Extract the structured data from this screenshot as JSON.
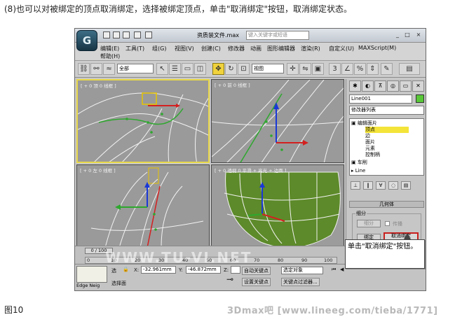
{
  "caption_top": "(8)也可以对被绑定的顶点取消绑定，选择被绑定顶点，单击\"取消绑定\"按钮，取消绑定状态。",
  "caption_bottom": "图10",
  "watermark_bottom": "3Dmax吧  [www.lineeg.com/tieba/1771]",
  "watermark_mid": "WWW.TU-VI.NET",
  "app": {
    "logo": "G",
    "title": "资质装文件.max",
    "search_placeholder": "键入关键字或短语",
    "window_buttons": [
      "_",
      "□",
      "×"
    ]
  },
  "menu": {
    "row1": [
      "编辑(E)",
      "工具(T)",
      "组(G)",
      "视图(V)",
      "创建(C)",
      "修改器",
      "动画",
      "图形编辑器",
      "渲染(R)",
      "自定义(U)",
      "MAXScript(M)"
    ],
    "row2": [
      "帮助(H)"
    ]
  },
  "toolbar": {
    "selection_filter": "全部",
    "reference_coord": "视图",
    "tool_icons": [
      "link-icon",
      "unlink-icon",
      "bind-space-warp-icon",
      "select-icon",
      "select-by-name-icon",
      "rect-select-icon",
      "window-crossing-icon",
      "move-icon",
      "rotate-icon",
      "scale-icon",
      "pivot-icon",
      "mirror-icon",
      "align-icon",
      "snap-icon",
      "angle-snap-icon",
      "percent-snap-icon",
      "spinner-snap-icon",
      "named-selection-icon",
      "render-icon"
    ]
  },
  "viewports": [
    {
      "label": "[ + 0 顶 0 线框 ]",
      "active": true
    },
    {
      "label": "[ + 0 前 0 线框 ]",
      "active": false
    },
    {
      "label": "[ + 0 左 0 线框 ]",
      "active": false
    },
    {
      "label": "[ + 0 透视 0 平滑 + 高光 + 边面 ]",
      "active": false
    }
  ],
  "command_panel": {
    "tabs": [
      "create-tab",
      "modify-tab",
      "hierarchy-tab",
      "motion-tab",
      "display-tab",
      "utilities-tab"
    ],
    "object_name": "Line001",
    "object_color": "#58c838",
    "modifier_list": "修改器列表",
    "stack": [
      {
        "text": "编辑面片",
        "level": 0,
        "selected": false
      },
      {
        "text": "顶点",
        "level": 1,
        "selected": true
      },
      {
        "text": "边",
        "level": 1,
        "selected": false
      },
      {
        "text": "面片",
        "level": 1,
        "selected": false
      },
      {
        "text": "元素",
        "level": 1,
        "selected": false
      },
      {
        "text": "控制柄",
        "level": 1,
        "selected": false
      },
      {
        "text": "车削",
        "level": 0,
        "selected": false
      },
      {
        "text": "Line",
        "level": 0,
        "selected": false
      }
    ],
    "rollout_title": "几何体",
    "group_title": "细分",
    "btn_subdivide": "细分",
    "chk_propagate": "传播",
    "btn_bind": "绑定",
    "btn_unbind": "取消绑定"
  },
  "callout": "单击\"取消绑定\"按钮。",
  "timeline": {
    "frame_display": "0 / 100",
    "ticks": [
      "0",
      "10",
      "20",
      "30",
      "40",
      "50",
      "60",
      "70",
      "80",
      "90",
      "100"
    ]
  },
  "status": {
    "select_label": "选",
    "x_label": "X:",
    "x_value": "-32.961mm",
    "y_label": "Y:",
    "y_value": "-46.872mm",
    "z_label": "Z:",
    "auto_key": "自动关键点",
    "set_key": "设置关键点",
    "selected_dropdown": "选定对象",
    "key_filters": "关键点过滤器...",
    "prompt": "选择面",
    "maxscript_label": "Edge Neig"
  }
}
